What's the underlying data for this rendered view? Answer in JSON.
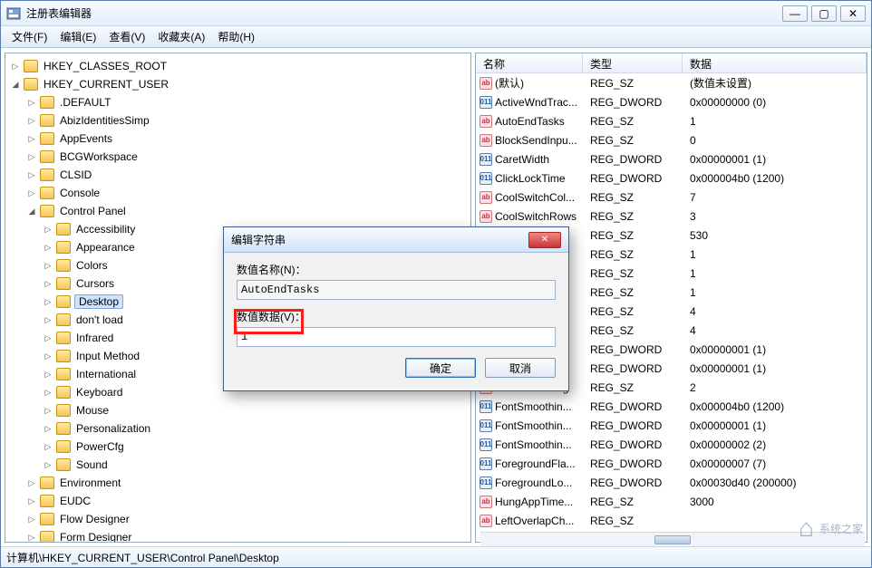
{
  "window": {
    "title": "注册表编辑器",
    "min": "—",
    "max": "▢",
    "close": "✕"
  },
  "menu": {
    "file": "文件(F)",
    "edit": "编辑(E)",
    "view": "查看(V)",
    "fav": "收藏夹(A)",
    "help": "帮助(H)"
  },
  "tree": {
    "root1": "HKEY_CLASSES_ROOT",
    "root2": "HKEY_CURRENT_USER",
    "children": [
      ".DEFAULT",
      "AbizIdentitiesSimp",
      "AppEvents",
      "BCGWorkspace",
      "CLSID",
      "Console",
      "Control Panel"
    ],
    "cpchildren": [
      "Accessibility",
      "Appearance",
      "Colors",
      "Cursors",
      "Desktop",
      "don't load",
      "Infrared",
      "Input Method",
      "International",
      "Keyboard",
      "Mouse",
      "Personalization",
      "PowerCfg",
      "Sound"
    ],
    "after": [
      "Environment",
      "EUDC",
      "Flow Designer",
      "Form Designer"
    ]
  },
  "list": {
    "col_name": "名称",
    "col_type": "类型",
    "col_data": "数据",
    "rows": [
      {
        "icon": "sz",
        "name": "(默认)",
        "type": "REG_SZ",
        "data": "(数值未设置)"
      },
      {
        "icon": "bin",
        "name": "ActiveWndTrac...",
        "type": "REG_DWORD",
        "data": "0x00000000 (0)"
      },
      {
        "icon": "sz",
        "name": "AutoEndTasks",
        "type": "REG_SZ",
        "data": "1"
      },
      {
        "icon": "sz",
        "name": "BlockSendInpu...",
        "type": "REG_SZ",
        "data": "0"
      },
      {
        "icon": "bin",
        "name": "CaretWidth",
        "type": "REG_DWORD",
        "data": "0x00000001 (1)"
      },
      {
        "icon": "bin",
        "name": "ClickLockTime",
        "type": "REG_DWORD",
        "data": "0x000004b0 (1200)"
      },
      {
        "icon": "sz",
        "name": "CoolSwitchCol...",
        "type": "REG_SZ",
        "data": "7"
      },
      {
        "icon": "sz",
        "name": "CoolSwitchRows",
        "type": "REG_SZ",
        "data": "3"
      },
      {
        "icon": "sz",
        "name": "",
        "type": "REG_SZ",
        "data": "530"
      },
      {
        "icon": "sz",
        "name": "",
        "type": "REG_SZ",
        "data": "1"
      },
      {
        "icon": "sz",
        "name": "",
        "type": "REG_SZ",
        "data": "1"
      },
      {
        "icon": "sz",
        "name": "",
        "type": "REG_SZ",
        "data": "1"
      },
      {
        "icon": "sz",
        "name": "",
        "type": "REG_SZ",
        "data": "4"
      },
      {
        "icon": "sz",
        "name": "",
        "type": "REG_SZ",
        "data": "4"
      },
      {
        "icon": "bin",
        "name": "",
        "type": "REG_DWORD",
        "data": "0x00000001 (1)"
      },
      {
        "icon": "bin",
        "name": "",
        "type": "REG_DWORD",
        "data": "0x00000001 (1)"
      },
      {
        "icon": "sz",
        "name": "FontSmoothing",
        "type": "REG_SZ",
        "data": "2"
      },
      {
        "icon": "bin",
        "name": "FontSmoothin...",
        "type": "REG_DWORD",
        "data": "0x000004b0 (1200)"
      },
      {
        "icon": "bin",
        "name": "FontSmoothin...",
        "type": "REG_DWORD",
        "data": "0x00000001 (1)"
      },
      {
        "icon": "bin",
        "name": "FontSmoothin...",
        "type": "REG_DWORD",
        "data": "0x00000002 (2)"
      },
      {
        "icon": "bin",
        "name": "ForegroundFla...",
        "type": "REG_DWORD",
        "data": "0x00000007 (7)"
      },
      {
        "icon": "bin",
        "name": "ForegroundLo...",
        "type": "REG_DWORD",
        "data": "0x00030d40 (200000)"
      },
      {
        "icon": "sz",
        "name": "HungAppTime...",
        "type": "REG_SZ",
        "data": "3000"
      },
      {
        "icon": "sz",
        "name": "LeftOverlapCh...",
        "type": "REG_SZ",
        "data": ""
      }
    ]
  },
  "dialog": {
    "title": "编辑字符串",
    "name_label": "数值名称(N)：",
    "name_value": "AutoEndTasks",
    "data_label": "数值数据(V)：",
    "data_value": "1",
    "ok": "确定",
    "cancel": "取消"
  },
  "status": "计算机\\HKEY_CURRENT_USER\\Control Panel\\Desktop",
  "watermark": "系统之家"
}
